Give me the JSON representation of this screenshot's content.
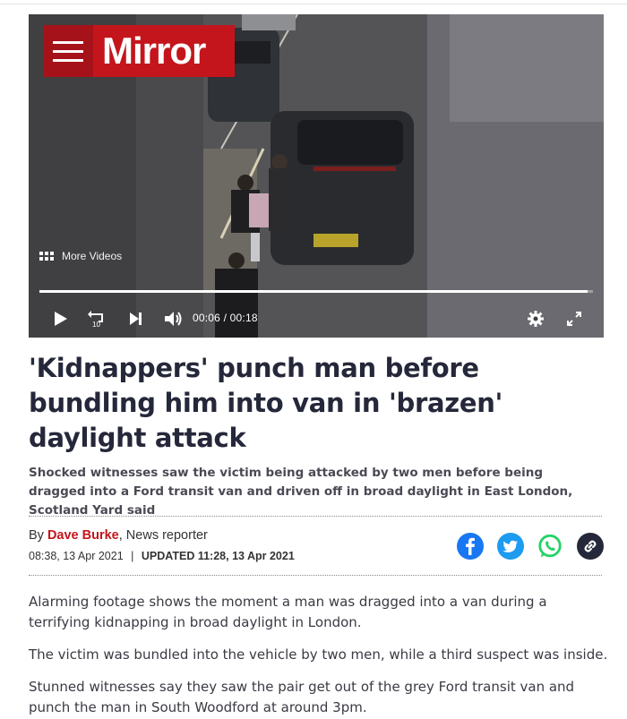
{
  "brand": {
    "logo_text": "Mirror",
    "colors": {
      "brand_red": "#c4151c",
      "headline": "#25273a",
      "facebook": "#1877f2",
      "twitter": "#1d9bf0",
      "whatsapp": "#25d366"
    }
  },
  "video": {
    "more_videos_label": "More Videos",
    "current_time": "00:06",
    "time_separator": "/",
    "duration": "00:18",
    "progress_fraction": 0.99,
    "controls": [
      "play-icon",
      "replay-10-icon",
      "skip-next-icon",
      "volume-icon",
      "settings-gear-icon",
      "fullscreen-icon"
    ],
    "replay_seconds": "10"
  },
  "article": {
    "headline": "'Kidnappers' punch man before bundling him into van in 'brazen' daylight attack",
    "standfirst": "Shocked witnesses saw the victim being attacked by two men before being dragged into a Ford transit van and driven off in broad daylight in East London, Scotland Yard said",
    "byline": {
      "prefix": "By",
      "author": "Dave Burke",
      "role": ", News reporter"
    },
    "published": "08:38, 13 Apr 2021",
    "separator": "|",
    "updated": "UPDATED 11:28, 13 Apr 2021",
    "share": [
      "facebook-icon",
      "twitter-icon",
      "whatsapp-icon",
      "link-icon"
    ],
    "paragraphs": [
      "Alarming footage shows the moment a man was dragged into a van during a terrifying kidnapping in broad daylight in London.",
      "The victim was bundled into the vehicle by two men, while a third suspect was inside.",
      "Stunned witnesses say they saw the pair get out of the grey Ford transit van and punch the man in South Woodford at around 3pm."
    ]
  }
}
